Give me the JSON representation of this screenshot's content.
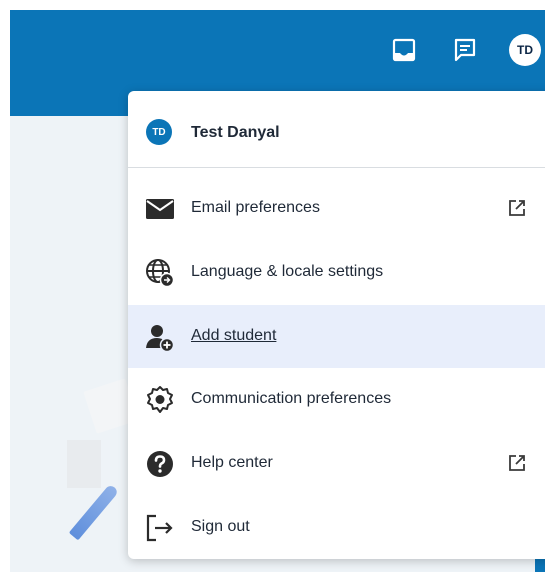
{
  "topbar": {
    "background_color": "#0b75b7",
    "icons": [
      "inbox-icon",
      "message-icon"
    ],
    "avatar_initials": "TD"
  },
  "menu": {
    "user": {
      "initials": "TD",
      "name": "Test Danyal"
    },
    "items": [
      {
        "label": "Email preferences",
        "icon": "mail-icon",
        "external": true
      },
      {
        "label": "Language & locale settings",
        "icon": "globe-icon",
        "external": false
      },
      {
        "label": "Add student",
        "icon": "add-user-icon",
        "external": false,
        "active": true
      },
      {
        "label": "Communication preferences",
        "icon": "gear-icon",
        "external": false
      },
      {
        "label": "Help center",
        "icon": "help-icon",
        "external": true
      },
      {
        "label": "Sign out",
        "icon": "sign-out-icon",
        "external": false
      }
    ],
    "active_background": "#e8eefb"
  }
}
